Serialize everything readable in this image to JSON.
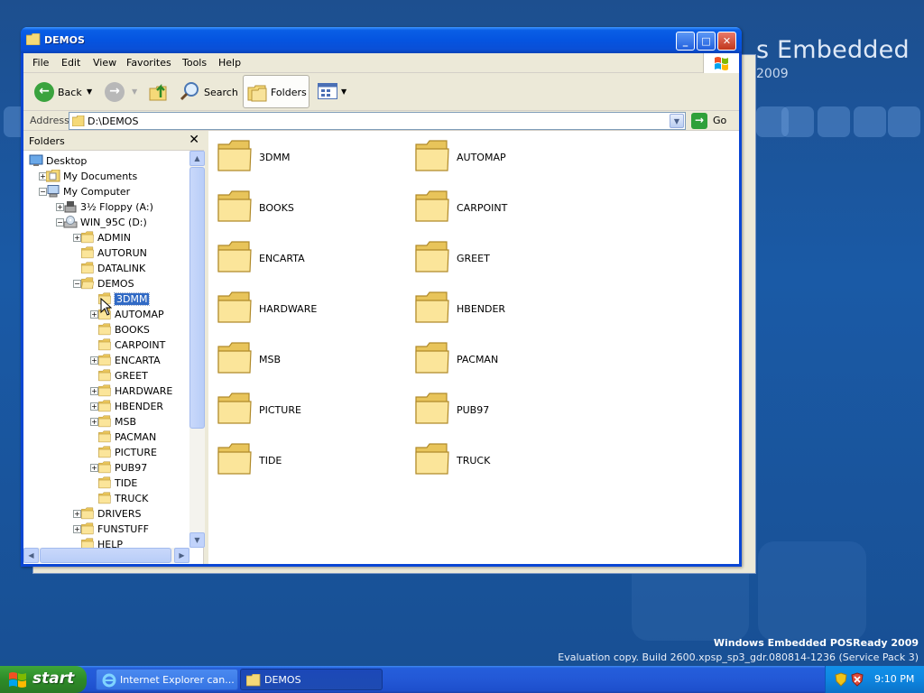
{
  "desktop": {
    "brand_text": "s Embedded",
    "brand_year": "2009",
    "watermark_title": "Windows Embedded POSReady 2009",
    "watermark_build": "Evaluation copy. Build 2600.xpsp_sp3_gdr.080814-1236 (Service Pack 3)"
  },
  "window": {
    "title": "DEMOS",
    "minimize": "_",
    "maximize": "□",
    "close": "✕"
  },
  "menu": [
    "File",
    "Edit",
    "View",
    "Favorites",
    "Tools",
    "Help"
  ],
  "toolbar": {
    "back_label": "Back",
    "search_label": "Search",
    "folders_label": "Folders"
  },
  "address": {
    "label": "Address",
    "value": "D:\\DEMOS",
    "go_label": "Go"
  },
  "folders_pane": {
    "title": "Folders",
    "close": "✕",
    "tree": [
      {
        "label": "Desktop",
        "level": 0,
        "expander": "",
        "icon": "desktop-icon"
      },
      {
        "label": "My Documents",
        "level": 1,
        "expander": "+",
        "icon": "my-documents-icon"
      },
      {
        "label": "My Computer",
        "level": 1,
        "expander": "−",
        "icon": "my-computer-icon"
      },
      {
        "label": "3½ Floppy (A:)",
        "level": 2,
        "expander": "+",
        "icon": "floppy-icon"
      },
      {
        "label": "WIN_95C (D:)",
        "level": 2,
        "expander": "−",
        "icon": "cd-drive-icon"
      },
      {
        "label": "ADMIN",
        "level": 3,
        "expander": "+",
        "icon": "folder-icon"
      },
      {
        "label": "AUTORUN",
        "level": 3,
        "expander": "",
        "icon": "folder-icon"
      },
      {
        "label": "DATALINK",
        "level": 3,
        "expander": "",
        "icon": "folder-icon"
      },
      {
        "label": "DEMOS",
        "level": 3,
        "expander": "−",
        "icon": "open-folder-icon"
      },
      {
        "label": "3DMM",
        "level": 4,
        "expander": "",
        "icon": "folder-icon",
        "selected": true
      },
      {
        "label": "AUTOMAP",
        "level": 4,
        "expander": "+",
        "icon": "folder-icon"
      },
      {
        "label": "BOOKS",
        "level": 4,
        "expander": "",
        "icon": "folder-icon"
      },
      {
        "label": "CARPOINT",
        "level": 4,
        "expander": "",
        "icon": "folder-icon"
      },
      {
        "label": "ENCARTA",
        "level": 4,
        "expander": "+",
        "icon": "folder-icon"
      },
      {
        "label": "GREET",
        "level": 4,
        "expander": "",
        "icon": "folder-icon"
      },
      {
        "label": "HARDWARE",
        "level": 4,
        "expander": "+",
        "icon": "folder-icon"
      },
      {
        "label": "HBENDER",
        "level": 4,
        "expander": "+",
        "icon": "folder-icon"
      },
      {
        "label": "MSB",
        "level": 4,
        "expander": "+",
        "icon": "folder-icon"
      },
      {
        "label": "PACMAN",
        "level": 4,
        "expander": "",
        "icon": "folder-icon"
      },
      {
        "label": "PICTURE",
        "level": 4,
        "expander": "",
        "icon": "folder-icon"
      },
      {
        "label": "PUB97",
        "level": 4,
        "expander": "+",
        "icon": "folder-icon"
      },
      {
        "label": "TIDE",
        "level": 4,
        "expander": "",
        "icon": "folder-icon"
      },
      {
        "label": "TRUCK",
        "level": 4,
        "expander": "",
        "icon": "folder-icon"
      },
      {
        "label": "DRIVERS",
        "level": 3,
        "expander": "+",
        "icon": "folder-icon"
      },
      {
        "label": "FUNSTUFF",
        "level": 3,
        "expander": "+",
        "icon": "folder-icon"
      },
      {
        "label": "HELP",
        "level": 3,
        "expander": "",
        "icon": "folder-icon"
      }
    ]
  },
  "content": {
    "folders": [
      "3DMM",
      "AUTOMAP",
      "BOOKS",
      "CARPOINT",
      "ENCARTA",
      "GREET",
      "HARDWARE",
      "HBENDER",
      "MSB",
      "PACMAN",
      "PICTURE",
      "PUB97",
      "TIDE",
      "TRUCK"
    ]
  },
  "taskbar": {
    "start_label": "start",
    "tasks": [
      {
        "label": "Internet Explorer can...",
        "icon": "internet-explorer-icon",
        "active": false
      },
      {
        "label": "DEMOS",
        "icon": "folder-icon",
        "active": true
      }
    ],
    "clock": "9:10 PM"
  },
  "colors": {
    "title_bar": "#0554e0",
    "selection": "#316ac5",
    "folder": "#f5d978",
    "taskbar": "#245edb",
    "start": "#2d8b28"
  }
}
